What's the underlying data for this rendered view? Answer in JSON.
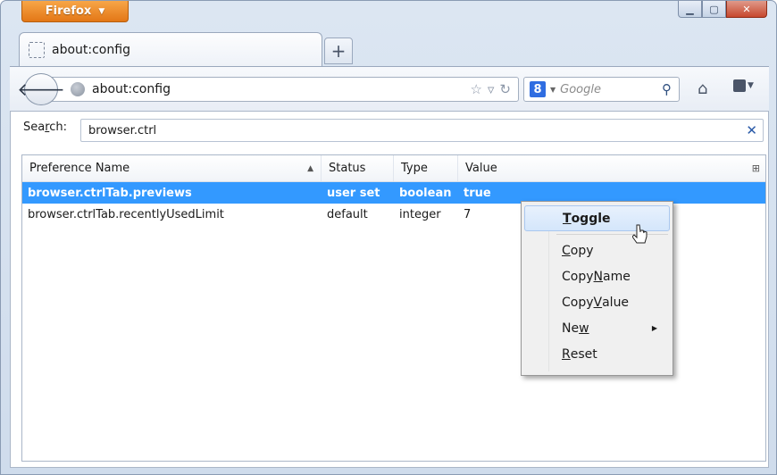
{
  "window": {
    "menu_button": "Firefox",
    "accent_color": "#e37716"
  },
  "tabs": [
    {
      "title": "about:config"
    }
  ],
  "navbar": {
    "url": "about:config",
    "search_engine": "Google",
    "search_placeholder": "Google"
  },
  "config": {
    "search_label_pre": "Sea",
    "search_label_mnemonic": "r",
    "search_label_post": "ch:",
    "search_value": "browser.ctrl",
    "columns": {
      "name": "Preference Name",
      "status": "Status",
      "type": "Type",
      "value": "Value"
    },
    "rows": [
      {
        "name": "browser.ctrlTab.previews",
        "status": "user set",
        "type": "boolean",
        "value": "true",
        "selected": true
      },
      {
        "name": "browser.ctrlTab.recentlyUsedLimit",
        "status": "default",
        "type": "integer",
        "value": "7",
        "selected": false
      }
    ]
  },
  "context_menu": {
    "items": [
      {
        "pre": "",
        "key": "T",
        "post": "oggle",
        "highlighted": true
      },
      {
        "pre": "",
        "key": "C",
        "post": "opy"
      },
      {
        "pre": "Copy ",
        "key": "N",
        "post": "ame"
      },
      {
        "pre": "Copy ",
        "key": "V",
        "post": "alue"
      },
      {
        "pre": "Ne",
        "key": "w",
        "post": "",
        "submenu": true
      },
      {
        "pre": "",
        "key": "R",
        "post": "eset"
      }
    ]
  }
}
